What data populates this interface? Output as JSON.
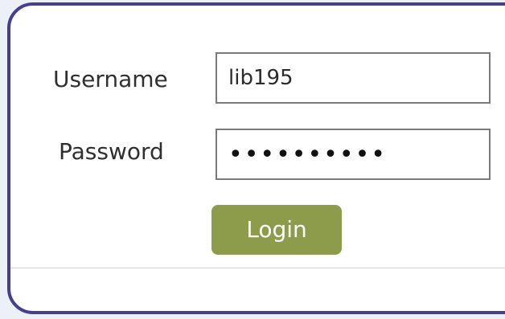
{
  "form": {
    "username": {
      "label": "Username",
      "value": "lib195"
    },
    "password": {
      "label": "Password",
      "value": "••••••••••"
    },
    "login_button": {
      "label": "Login"
    }
  },
  "colors": {
    "panel_border": "#453f8f",
    "button_background": "#8d9c4a",
    "button_text": "#ffffff",
    "field_border": "#7b7b7b"
  }
}
